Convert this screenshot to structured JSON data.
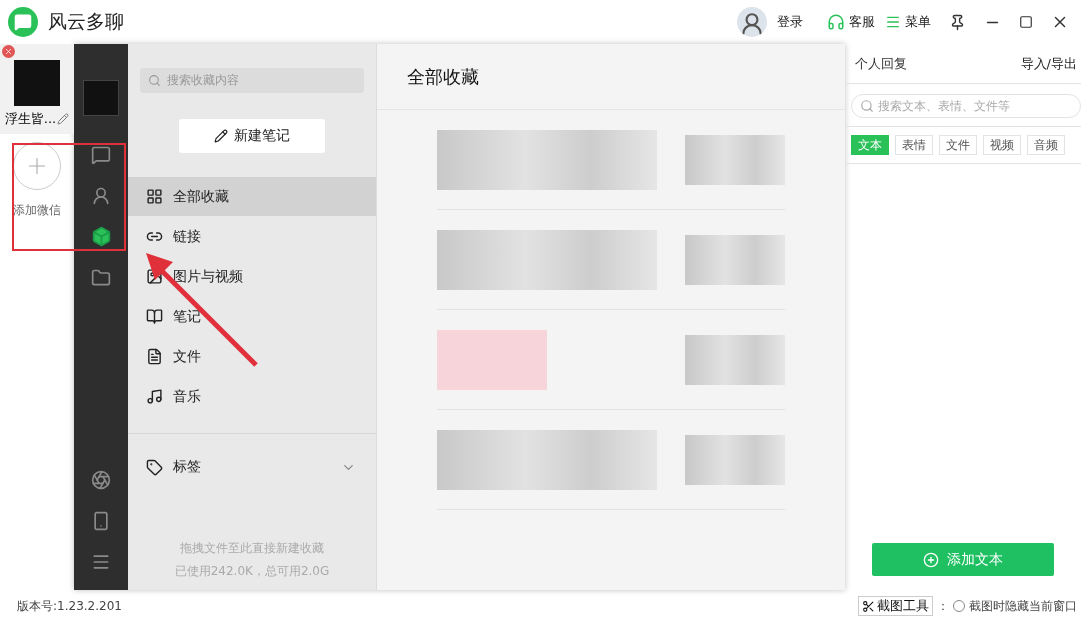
{
  "app": {
    "title": "风云多聊"
  },
  "header": {
    "login": "登录",
    "service": "客服",
    "menu": "菜单"
  },
  "accounts": [
    {
      "name": "浮生皆..."
    }
  ],
  "add_account": "添加微信",
  "nav_rail": [
    {
      "kind": "chat",
      "selected": false
    },
    {
      "kind": "contacts",
      "selected": false
    },
    {
      "kind": "favorites",
      "selected": true
    },
    {
      "kind": "folder",
      "selected": false
    }
  ],
  "nav_bottom": [
    {
      "kind": "miniapp"
    },
    {
      "kind": "phone"
    },
    {
      "kind": "menu"
    }
  ],
  "favorites": {
    "search_placeholder": "搜索收藏内容",
    "new_note": "新建笔记",
    "categories": [
      {
        "kind": "all",
        "label": "全部收藏",
        "selected": true
      },
      {
        "kind": "link",
        "label": "链接",
        "selected": false
      },
      {
        "kind": "media",
        "label": "图片与视频",
        "selected": false
      },
      {
        "kind": "note",
        "label": "笔记",
        "selected": false
      },
      {
        "kind": "file",
        "label": "文件",
        "selected": false
      },
      {
        "kind": "music",
        "label": "音乐",
        "selected": false
      }
    ],
    "tags": {
      "label": "标签",
      "expanded": false
    },
    "drop_hint": "拖拽文件至此直接新建收藏",
    "usage": "已使用242.0K，总可用2.0G"
  },
  "content": {
    "title": "全部收藏",
    "items": [
      {
        "kind": "blurred"
      },
      {
        "kind": "blurred"
      },
      {
        "kind": "image"
      },
      {
        "kind": "blurred"
      }
    ]
  },
  "quick_reply": {
    "title": "个人回复",
    "import_export": "导入/导出",
    "search_placeholder": "搜索文本、表情、文件等",
    "tabs": [
      {
        "label": "文本",
        "selected": true
      },
      {
        "label": "表情",
        "selected": false
      },
      {
        "label": "文件",
        "selected": false
      },
      {
        "label": "视频",
        "selected": false
      },
      {
        "label": "音频",
        "selected": false
      }
    ],
    "add_button": "添加文本"
  },
  "status_bar": {
    "version": "版本号:1.23.2.201",
    "screenshot_tool": "截图工具",
    "separator": "：",
    "hide_option": {
      "label": "截图时隐藏当前窗口",
      "checked": false
    }
  }
}
